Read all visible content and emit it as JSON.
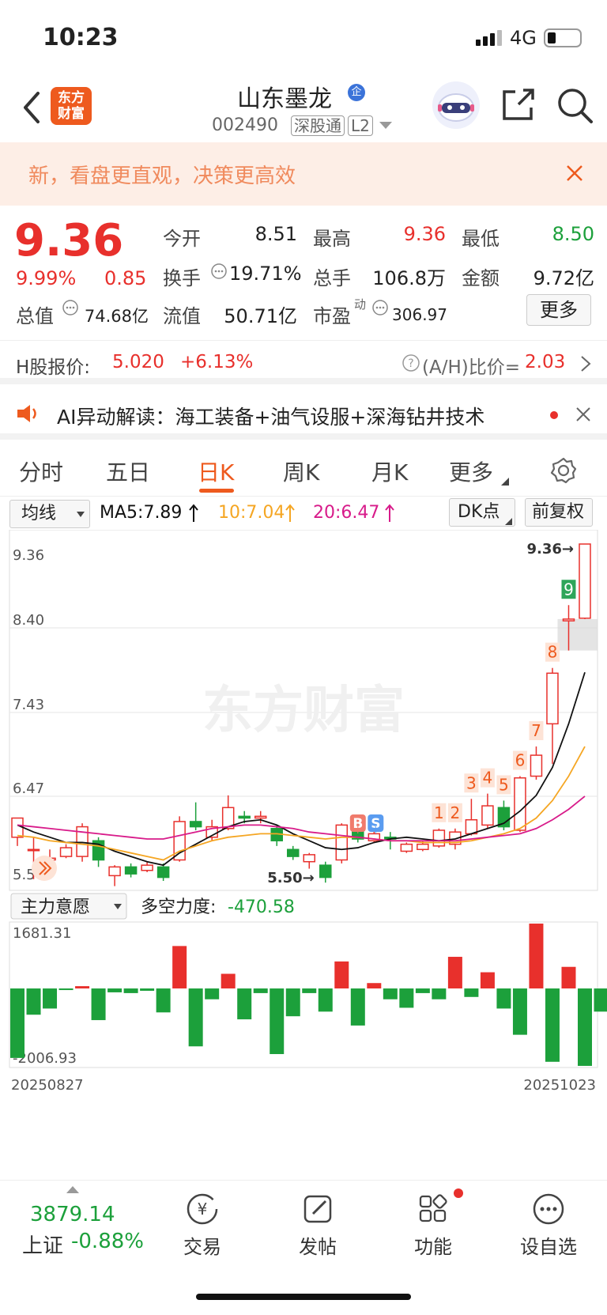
{
  "status_bar": {
    "time": "10:23",
    "network": "4G"
  },
  "header": {
    "brand_logo": "东方\n财富",
    "stock_name": "山东墨龙",
    "stock_code": "002490",
    "tag_1": "深股通",
    "tag_2": "L2",
    "badge": "企"
  },
  "banner": {
    "text": "新，看盘更直观，决策更高效"
  },
  "quote": {
    "price": "9.36",
    "change_pct": "9.99%",
    "change_amt": "0.85",
    "open_label": "今开",
    "open": "8.51",
    "high_label": "最高",
    "high": "9.36",
    "low_label": "最低",
    "low": "8.50",
    "turnover_label": "换手",
    "turnover": "19.71%",
    "volume_label": "总手",
    "volume": "106.8万",
    "amount_label": "金额",
    "amount": "9.72亿",
    "mktcap_label": "总值",
    "mktcap": "74.68亿",
    "float_label": "流值",
    "float": "50.71亿",
    "pe_label": "市盈",
    "pe_sup": "动",
    "pe": "306.97",
    "more_label": "更多"
  },
  "h_share": {
    "label": "H股报价:",
    "price": "5.020",
    "change": "+6.13%",
    "ratio_label": "(A/H)比价=",
    "ratio": "2.03"
  },
  "ai_row": {
    "text": "AI异动解读：海工装备+油气设服+深海钻井技术"
  },
  "tabs": [
    "分时",
    "五日",
    "日K",
    "周K",
    "月K",
    "更多"
  ],
  "active_tab": "日K",
  "controls": {
    "ma_select": "均线",
    "ma5": "MA5:7.89",
    "ma10": "10:7.04",
    "ma20": "20:6.47",
    "dk_label": "DK点",
    "adjust_label": "前复权"
  },
  "colors": {
    "up": "#e8302c",
    "down": "#1ca03b",
    "accent": "#ee5a1e",
    "ma5": "#111111",
    "ma10": "#f5a623",
    "ma20": "#d81b8a"
  },
  "chart_data": {
    "type": "candlestick",
    "y_ticks": [
      "9.36",
      "8.40",
      "7.43",
      "6.47",
      "5.50"
    ],
    "ylim": [
      5.5,
      9.36
    ],
    "low_marker": "5.50",
    "high_marker": "9.36",
    "candles": [
      {
        "o": 6.0,
        "c": 6.22,
        "h": 6.22,
        "l": 5.9
      },
      {
        "o": 5.86,
        "c": 5.86,
        "h": 6.0,
        "l": 5.52
      },
      {
        "o": 5.74,
        "c": 5.76,
        "h": 5.86,
        "l": 5.66
      },
      {
        "o": 5.78,
        "c": 5.88,
        "h": 5.92,
        "l": 5.76
      },
      {
        "o": 5.78,
        "c": 6.12,
        "h": 6.16,
        "l": 5.72
      },
      {
        "o": 5.96,
        "c": 5.74,
        "h": 6.0,
        "l": 5.66
      },
      {
        "o": 5.56,
        "c": 5.66,
        "h": 5.68,
        "l": 5.44
      },
      {
        "o": 5.66,
        "c": 5.58,
        "h": 5.7,
        "l": 5.54
      },
      {
        "o": 5.62,
        "c": 5.68,
        "h": 5.72,
        "l": 5.6
      },
      {
        "o": 5.66,
        "c": 5.54,
        "h": 5.7,
        "l": 5.5
      },
      {
        "o": 5.74,
        "c": 6.18,
        "h": 6.24,
        "l": 5.72
      },
      {
        "o": 6.18,
        "c": 6.12,
        "h": 6.4,
        "l": 6.08
      },
      {
        "o": 6.0,
        "c": 6.12,
        "h": 6.2,
        "l": 5.96
      },
      {
        "o": 6.1,
        "c": 6.34,
        "h": 6.48,
        "l": 6.08
      },
      {
        "o": 6.24,
        "c": 6.22,
        "h": 6.3,
        "l": 6.16
      },
      {
        "o": 6.22,
        "c": 6.24,
        "h": 6.3,
        "l": 6.16
      },
      {
        "o": 6.1,
        "c": 5.96,
        "h": 6.14,
        "l": 5.9
      },
      {
        "o": 5.86,
        "c": 5.78,
        "h": 5.9,
        "l": 5.74
      },
      {
        "o": 5.72,
        "c": 5.8,
        "h": 5.82,
        "l": 5.64
      },
      {
        "o": 5.68,
        "c": 5.54,
        "h": 5.72,
        "l": 5.48
      },
      {
        "o": 5.74,
        "c": 6.14,
        "h": 6.16,
        "l": 5.7
      },
      {
        "o": 6.08,
        "c": 5.98,
        "h": 6.12,
        "l": 5.94
      },
      {
        "o": 5.96,
        "c": 6.04,
        "h": 6.1,
        "l": 5.94
      },
      {
        "o": 6.0,
        "c": 5.98,
        "h": 6.06,
        "l": 5.86
      },
      {
        "o": 5.84,
        "c": 5.92,
        "h": 5.94,
        "l": 5.82
      },
      {
        "o": 5.86,
        "c": 5.92,
        "h": 5.96,
        "l": 5.84
      },
      {
        "o": 5.9,
        "c": 6.08,
        "h": 6.1,
        "l": 5.88
      },
      {
        "o": 5.92,
        "c": 6.06,
        "h": 6.1,
        "l": 5.86
      },
      {
        "o": 6.04,
        "c": 6.2,
        "h": 6.44,
        "l": 6.02
      },
      {
        "o": 6.14,
        "c": 6.36,
        "h": 6.5,
        "l": 6.1
      },
      {
        "o": 6.34,
        "c": 6.12,
        "h": 6.42,
        "l": 6.08
      },
      {
        "o": 6.08,
        "c": 6.68,
        "h": 6.7,
        "l": 6.06
      },
      {
        "o": 6.7,
        "c": 6.94,
        "h": 7.04,
        "l": 6.66
      },
      {
        "o": 7.3,
        "c": 7.88,
        "h": 7.94,
        "l": 6.84
      },
      {
        "o": 8.48,
        "c": 8.5,
        "h": 8.66,
        "l": 8.14
      },
      {
        "o": 8.51,
        "c": 9.36,
        "h": 9.36,
        "l": 8.5
      }
    ],
    "ma5": [
      6.14,
      6.06,
      6.0,
      5.94,
      5.94,
      5.92,
      5.84,
      5.78,
      5.72,
      5.68,
      5.82,
      5.92,
      6.02,
      6.12,
      6.18,
      6.2,
      6.14,
      6.04,
      5.96,
      5.88,
      5.86,
      5.88,
      5.94,
      5.98,
      6.0,
      5.98,
      5.96,
      5.98,
      6.04,
      6.1,
      6.16,
      6.3,
      6.48,
      6.8,
      7.3,
      7.89
    ],
    "ma10": [
      6.02,
      6.0,
      5.96,
      5.94,
      5.92,
      5.9,
      5.86,
      5.82,
      5.78,
      5.74,
      5.84,
      5.9,
      5.96,
      6.0,
      6.02,
      6.04,
      6.04,
      6.02,
      6.0,
      5.98,
      6.0,
      6.0,
      5.98,
      5.96,
      5.96,
      5.94,
      5.94,
      5.94,
      5.96,
      6.0,
      6.04,
      6.1,
      6.22,
      6.42,
      6.7,
      7.04
    ],
    "ma20": [
      6.14,
      6.12,
      6.1,
      6.08,
      6.06,
      6.04,
      6.02,
      6.0,
      5.98,
      5.98,
      6.02,
      6.06,
      6.1,
      6.12,
      6.14,
      6.14,
      6.12,
      6.1,
      6.06,
      6.04,
      6.02,
      6.0,
      5.98,
      5.96,
      5.96,
      5.96,
      5.96,
      5.96,
      5.98,
      6.0,
      6.02,
      6.04,
      6.1,
      6.2,
      6.32,
      6.47
    ],
    "signals": [
      {
        "label": "1",
        "index": 26
      },
      {
        "label": "2",
        "index": 27
      },
      {
        "label": "3",
        "index": 28
      },
      {
        "label": "4",
        "index": 29
      },
      {
        "label": "5",
        "index": 30
      },
      {
        "label": "6",
        "index": 31
      },
      {
        "label": "7",
        "index": 32
      },
      {
        "label": "8",
        "index": 33
      },
      {
        "label": "9",
        "index": 34
      }
    ],
    "bs_markers": [
      {
        "label": "B",
        "index": 21
      },
      {
        "label": "S",
        "index": 22
      }
    ],
    "indicator_select": "主力意愿",
    "indicator_label": "多空力度:",
    "indicator_value": "-470.58",
    "indicator_max": "1681.31",
    "indicator_min": "-2006.93",
    "indicator_values": [
      -1800,
      -680,
      -520,
      -30,
      60,
      -820,
      -100,
      -120,
      -60,
      -620,
      1100,
      -1500,
      -280,
      380,
      -800,
      -120,
      -1700,
      -720,
      -120,
      -600,
      700,
      -960,
      140,
      -280,
      -500,
      -120,
      -280,
      820,
      -220,
      420,
      -520,
      -1200,
      1681,
      -1900,
      560,
      -2006,
      -600
    ],
    "date_start": "20250827",
    "date_end": "20251023",
    "watermark": "东方财富"
  },
  "bottom_bar": {
    "index_value": "3879.14",
    "index_name": "上证",
    "index_change": "-0.88%",
    "items": [
      "交易",
      "发帖",
      "功能",
      "设自选"
    ]
  }
}
